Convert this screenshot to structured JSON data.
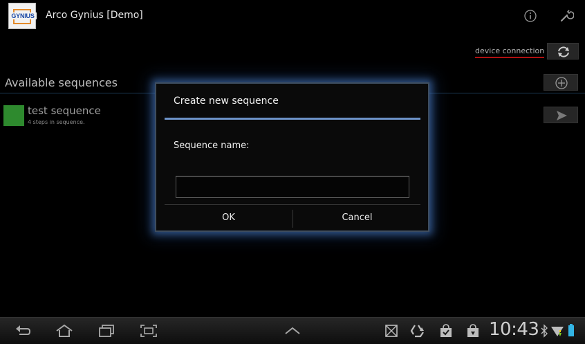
{
  "app": {
    "logo_text": "GYNIUS",
    "title": "Arco Gynius [Demo]"
  },
  "toolbar": {
    "info_icon": "info-icon",
    "settings_icon": "wrench-icon",
    "device_connection_label": "device connection",
    "refresh_icon": "refresh-icon",
    "add_icon": "add-circle-icon",
    "send_icon": "send-icon"
  },
  "sequences": {
    "section_title": "Available sequences",
    "items": [
      {
        "name": "test sequence",
        "subtitle": "4 steps in sequence.",
        "color": "#2e8a2e"
      }
    ]
  },
  "dialog": {
    "title": "Create new sequence",
    "field_label": "Sequence name:",
    "field_value": "",
    "ok_label": "OK",
    "cancel_label": "Cancel",
    "accent": "#6d93c9"
  },
  "system_bar": {
    "clock": "10:43",
    "nav_icons": [
      "back-icon",
      "home-icon",
      "recent-apps-icon",
      "screenshot-icon",
      "up-arrow-icon"
    ],
    "status_icons": [
      "screenshot-status-icon",
      "recycle-icon",
      "shopping-bag-check-icon",
      "shopping-bag-download-icon",
      "bluetooth-icon",
      "wifi-icon",
      "battery-icon"
    ]
  }
}
